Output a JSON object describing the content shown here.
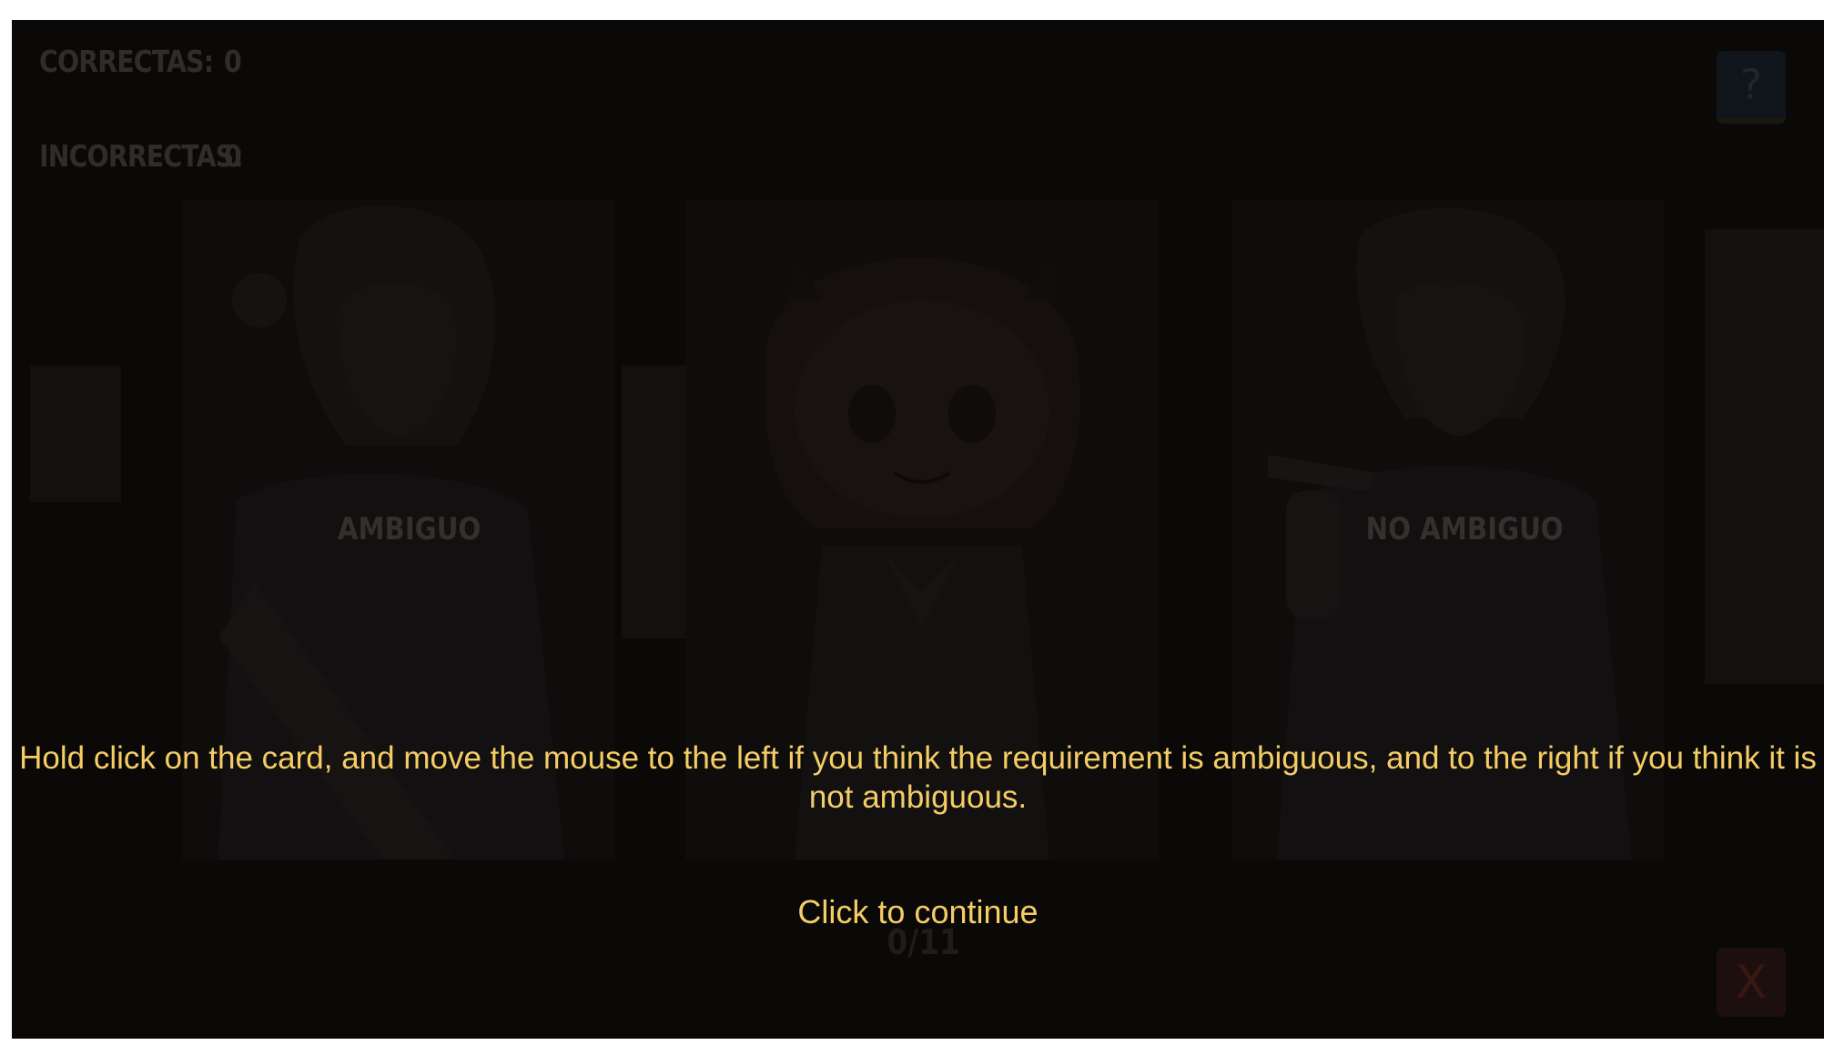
{
  "hud": {
    "correct_label": "CORRECTAS:",
    "correct_value": "0",
    "incorrect_label": "INCORRECTAS:",
    "incorrect_value": "0"
  },
  "zones": {
    "left_label": "AMBIGUO",
    "right_label": "NO AMBIGUO"
  },
  "progress": {
    "text": "0/11",
    "current": 0,
    "total": 11
  },
  "buttons": {
    "help_label": "?",
    "close_label": "X"
  },
  "overlay": {
    "instruction": "Hold click on the card, and move the mouse to the left if you think the requirement is ambiguous, and to the right if you think it is not ambiguous.",
    "continue_label": "Click to continue"
  },
  "colors": {
    "overlay_text": "#f5cd66",
    "help_button": "#0f151a",
    "close_button": "#1d0f0d"
  }
}
